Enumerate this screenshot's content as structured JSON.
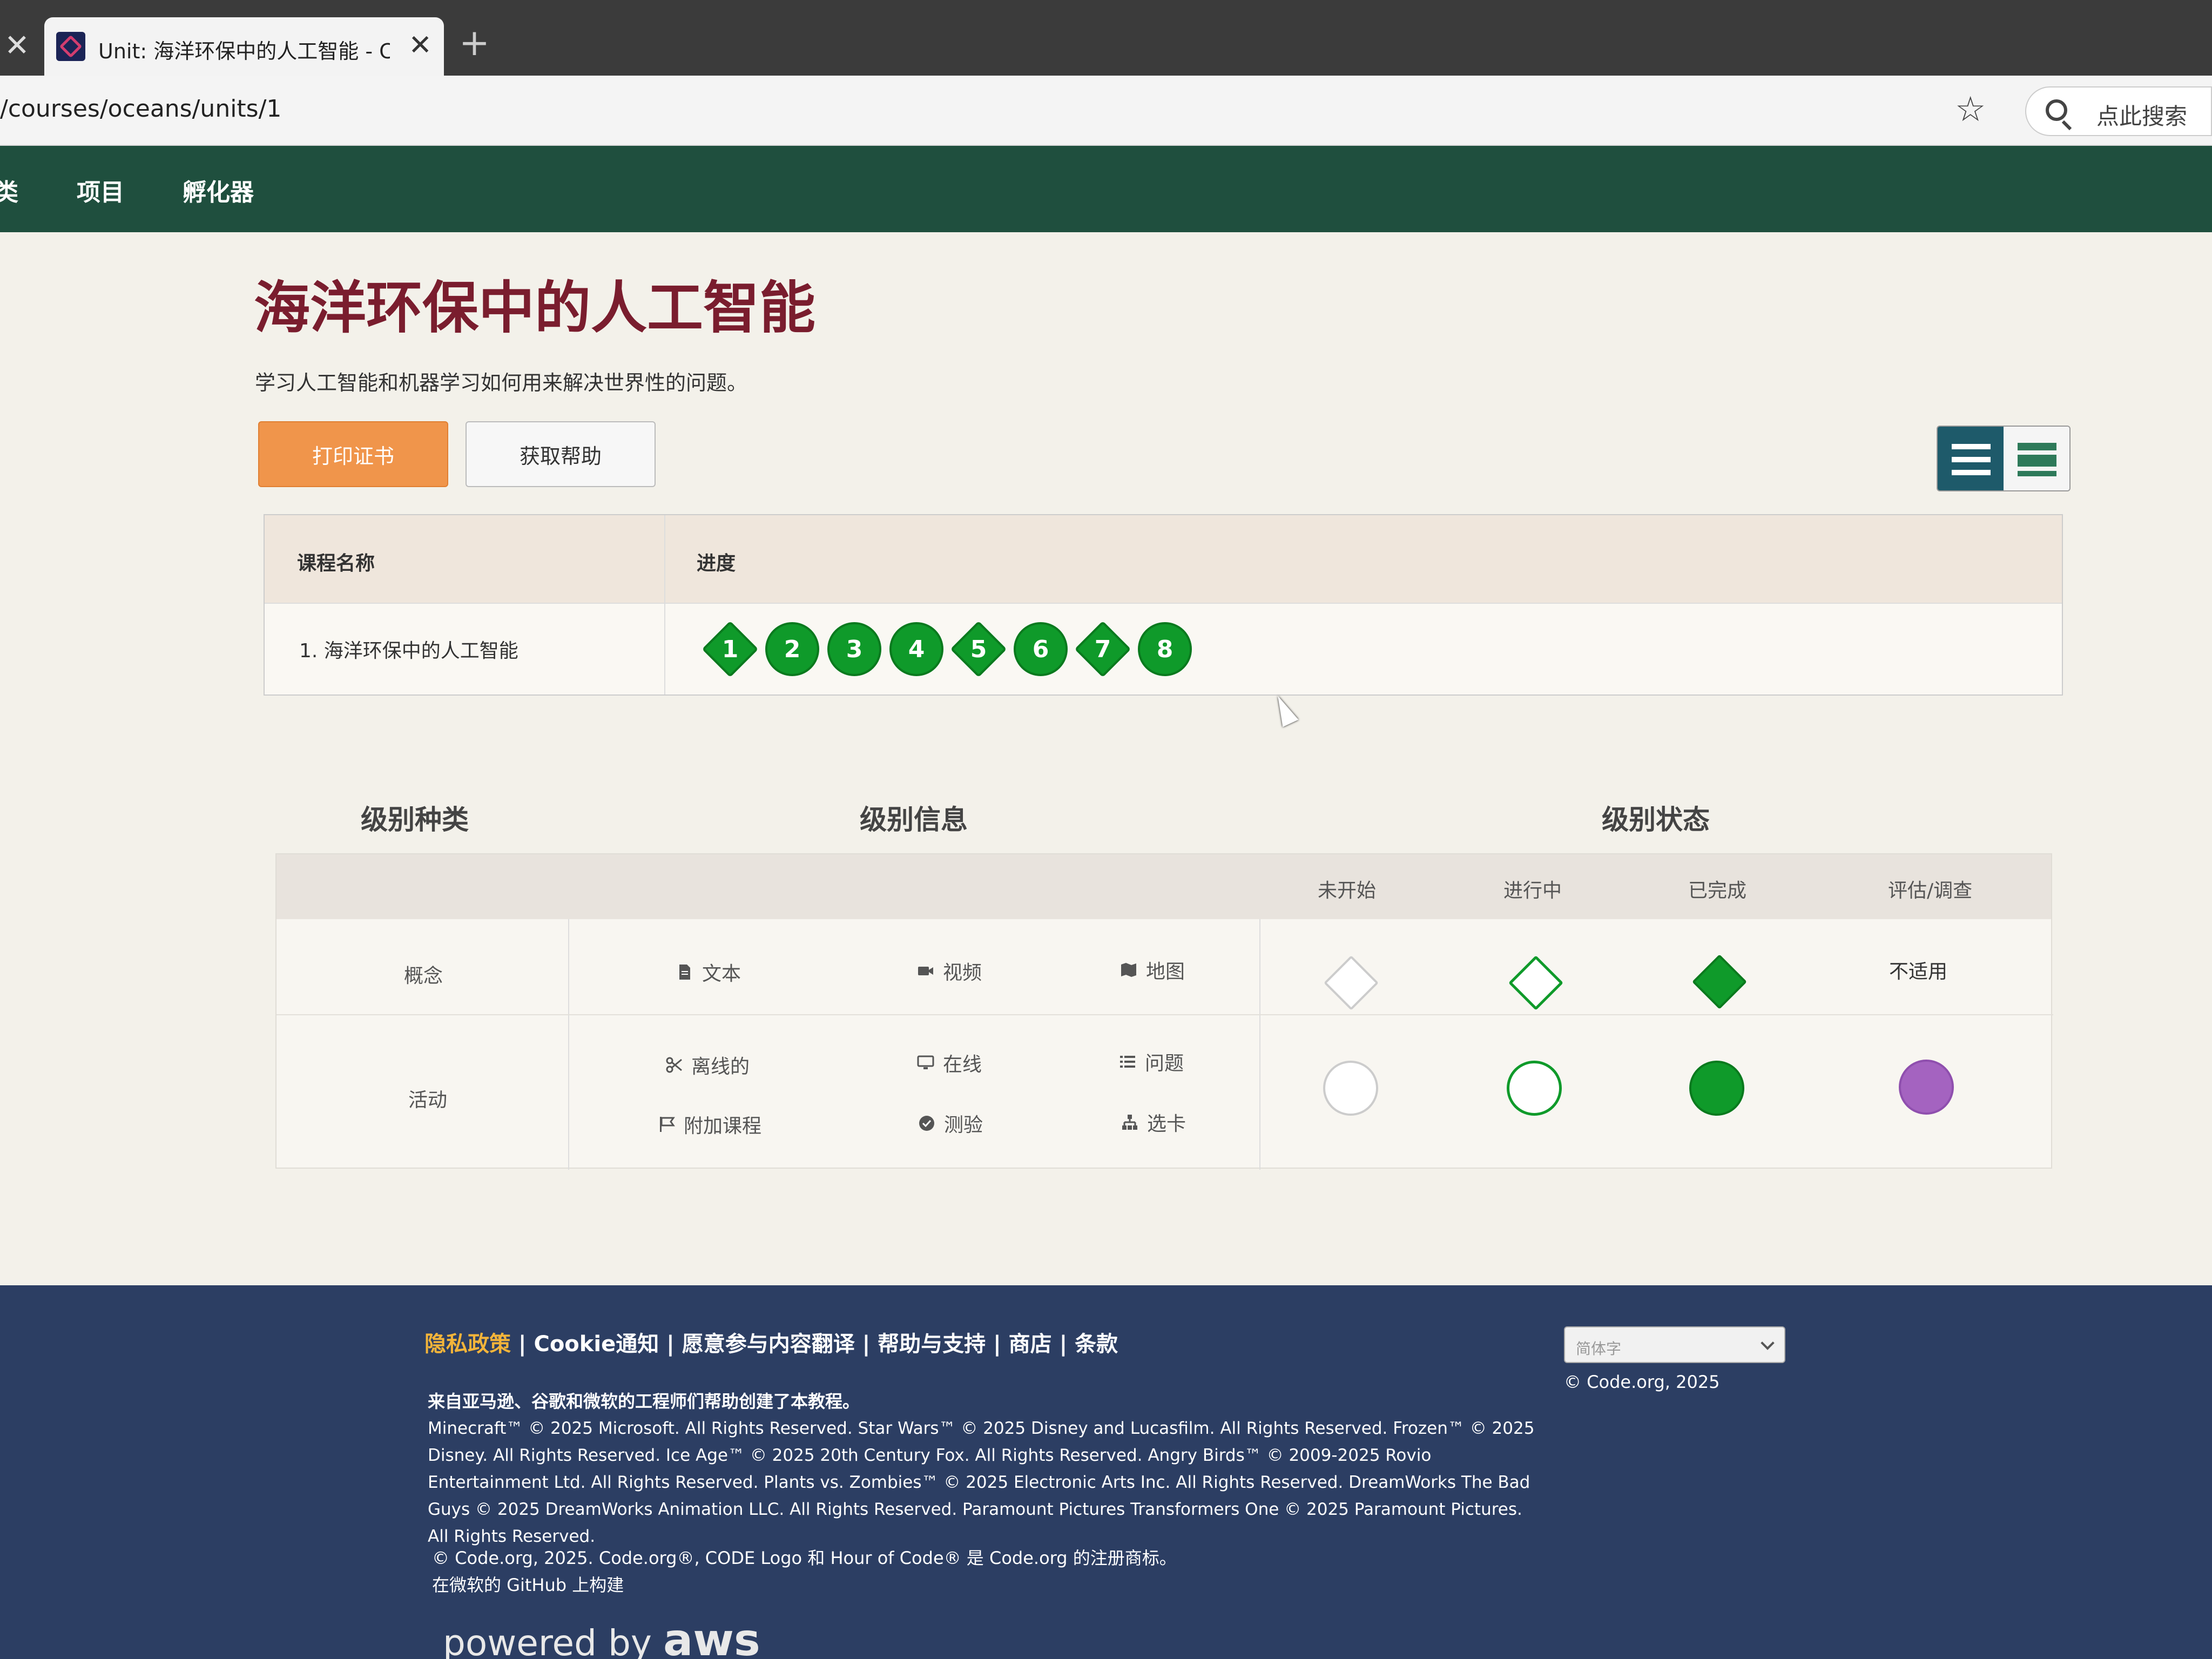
{
  "browser": {
    "tab_title": "Unit: 海洋环保中的人工智能 - Coc",
    "prev_tab_close": "✕",
    "tab_close": "✕",
    "new_tab": "+",
    "url": "/courses/oceans/units/1",
    "star_icon": "☆",
    "search_placeholder": "点此搜索"
  },
  "nav": {
    "items": [
      "类",
      "项目",
      "孵化器"
    ]
  },
  "page": {
    "title": "海洋环保中的人工智能",
    "subtitle": "学习人工智能和机器学习如何用来解决世界性的问题。",
    "print_button": "打印证书",
    "help_button": "获取帮助"
  },
  "progress_table": {
    "col_name": "课程名称",
    "col_progress": "进度",
    "lesson": "1. 海洋环保中的人工智能",
    "levels": [
      {
        "label": "1",
        "shape": "diamond"
      },
      {
        "label": "2",
        "shape": "circle"
      },
      {
        "label": "3",
        "shape": "circle"
      },
      {
        "label": "4",
        "shape": "circle"
      },
      {
        "label": "5",
        "shape": "diamond"
      },
      {
        "label": "6",
        "shape": "circle"
      },
      {
        "label": "7",
        "shape": "diamond"
      },
      {
        "label": "8",
        "shape": "circle"
      }
    ],
    "bubble_color": "#0f9a2a"
  },
  "legend": {
    "heading_type": "级别种类",
    "heading_info": "级别信息",
    "heading_status": "级别状态",
    "status_cols": [
      "未开始",
      "进行中",
      "已完成",
      "评估/调查"
    ],
    "row_concept": "概念",
    "row_activity": "活动",
    "concept_items": [
      "文本",
      "视频",
      "地图"
    ],
    "activity_items": [
      "离线的",
      "在线",
      "问题",
      "附加课程",
      "测验",
      "选卡"
    ],
    "not_applicable": "不适用",
    "colors": {
      "not_started": "#cccccc",
      "in_progress": "#0f9a2a",
      "completed": "#0f9a2a",
      "assessment": "#a463c0"
    }
  },
  "footer": {
    "links": [
      "隐私政策",
      "Cookie通知",
      "愿意参与内容翻译",
      "帮助与支持",
      "商店",
      "条款"
    ],
    "separator": " | ",
    "language": "简体字",
    "copyright_right": "© Code.org, 2025",
    "credit": "来自亚马逊、谷歌和微软的工程师们帮助创建了本教程。",
    "legal": "Minecraft™ © 2025 Microsoft. All Rights Reserved. Star Wars™ © 2025 Disney and Lucasfilm. All Rights Reserved. Frozen™ © 2025 Disney. All Rights Reserved. Ice Age™ © 2025 20th Century Fox. All Rights Reserved. Angry Birds™ © 2009-2025 Rovio Entertainment Ltd. All Rights Reserved. Plants vs. Zombies™ © 2025 Electronic Arts Inc. All Rights Reserved. DreamWorks The Bad Guys © 2025 DreamWorks Animation LLC. All Rights Reserved. Paramount Pictures Transformers One © 2025 Paramount Pictures. All Rights Reserved.",
    "trademark": "© Code.org, 2025. Code.org®, CODE Logo 和 Hour of Code® 是 Code.org 的注册商标。",
    "github": "在微软的 GitHub 上构建",
    "powered_by": "powered by",
    "powered_brand": "aws"
  }
}
